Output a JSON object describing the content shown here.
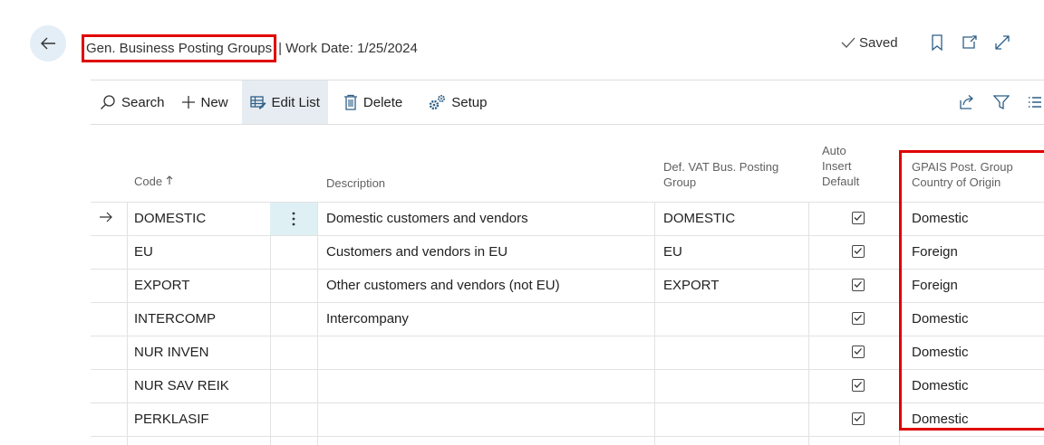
{
  "header": {
    "title": "Gen. Business Posting Groups",
    "work_date": "| Work Date: 1/25/2024",
    "saved_label": "Saved"
  },
  "actions": {
    "search": "Search",
    "new": "New",
    "edit_list": "Edit List",
    "delete": "Delete",
    "setup": "Setup"
  },
  "columns": {
    "code": "Code",
    "description": "Description",
    "def_vat_line1": "Def. VAT Bus. Posting",
    "def_vat_line2": "Group",
    "auto_line1": "Auto",
    "auto_line2": "Insert",
    "auto_line3": "Default",
    "gpais_line1": "GPAIS Post. Group",
    "gpais_line2": "Country of Origin"
  },
  "rows": [
    {
      "code": "DOMESTIC",
      "description": "Domestic customers and vendors",
      "def_vat": "DOMESTIC",
      "auto_insert": true,
      "gpais": "Domestic"
    },
    {
      "code": "EU",
      "description": "Customers and vendors in EU",
      "def_vat": "EU",
      "auto_insert": true,
      "gpais": "Foreign"
    },
    {
      "code": "EXPORT",
      "description": "Other customers and vendors (not EU)",
      "def_vat": "EXPORT",
      "auto_insert": true,
      "gpais": "Foreign"
    },
    {
      "code": "INTERCOMP",
      "description": "Intercompany",
      "def_vat": "",
      "auto_insert": true,
      "gpais": "Domestic"
    },
    {
      "code": "NUR INVEN",
      "description": "",
      "def_vat": "",
      "auto_insert": true,
      "gpais": "Domestic"
    },
    {
      "code": "NUR SAV REIK",
      "description": "",
      "def_vat": "",
      "auto_insert": true,
      "gpais": "Domestic"
    },
    {
      "code": "PERKLASIF",
      "description": "",
      "def_vat": "",
      "auto_insert": true,
      "gpais": "Domestic"
    }
  ],
  "colors": {
    "highlight": "#e00000",
    "selected_cell_bg": "#dff0f4",
    "active_action_bg": "#e6ecf2"
  }
}
